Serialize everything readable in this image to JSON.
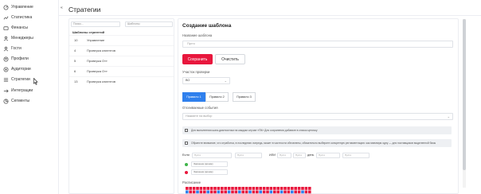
{
  "sidebar": {
    "items": [
      {
        "label": "Управление",
        "icon": "dashboard-icon"
      },
      {
        "label": "Статистика",
        "icon": "chart-icon"
      },
      {
        "label": "Финансы",
        "icon": "wallet-icon"
      },
      {
        "label": "Менеджеры",
        "icon": "user-icon"
      },
      {
        "label": "Гости",
        "icon": "guest-icon"
      },
      {
        "label": "Профили",
        "icon": "profile-icon"
      },
      {
        "label": "Аудитории",
        "icon": "audience-icon"
      },
      {
        "label": "Стратегии",
        "icon": "strategy-icon"
      },
      {
        "label": "Интеграции",
        "icon": "integration-icon"
      },
      {
        "label": "Сегменты",
        "icon": "segment-icon"
      }
    ]
  },
  "header": {
    "title": "Стратегии",
    "collapse": "«"
  },
  "left": {
    "search_placeholder": "Поиск...",
    "filter_value": "Шаблоны",
    "list_title": "Шаблоны стратегий",
    "rows": [
      {
        "id": "10",
        "name": "Управление"
      },
      {
        "id": "4",
        "name": "Проверка клиентов"
      },
      {
        "id": "5",
        "name": "Проверка Отт"
      },
      {
        "id": "6",
        "name": "Проверка Отт"
      },
      {
        "id": "13",
        "name": "Проверка клиентов"
      }
    ]
  },
  "form": {
    "title": "Создание шаблона",
    "name_label": "Название шаблона",
    "name_placeholder": "Пусто",
    "save": "Сохранить",
    "clear": "Очистить",
    "part_label": "Участок проверки",
    "part_value": "ВО",
    "tabs": [
      "Правило 1",
      "Правило 2",
      "Правило 3"
    ],
    "blacklist_label": "Отсеиваемые события",
    "blacklist_placeholder": "Нажмите на выбор",
    "notice1": "Для выполнения шага-диагностики на каждом случае «ПК» Для сохранения добавьте в список цепочку",
    "notice2": "Обратите внимание, что отработка, в последнюю очередь, может в частности обновлены, обязательно выберите конкретную регламентацию: как минимум одну — для поставщиков выделенной базы",
    "cond_if": "Если",
    "cond_empty": "Пусто",
    "cond_or": "ИЛИ",
    "cond_day": "день",
    "rule1": "Значение (кроме)",
    "rule2": "Значение (кроме)",
    "schedule_label": "Расписание",
    "chevron": "⌄"
  },
  "colors": {
    "accent": "#e8173d",
    "tab_active": "#2f80ed"
  }
}
